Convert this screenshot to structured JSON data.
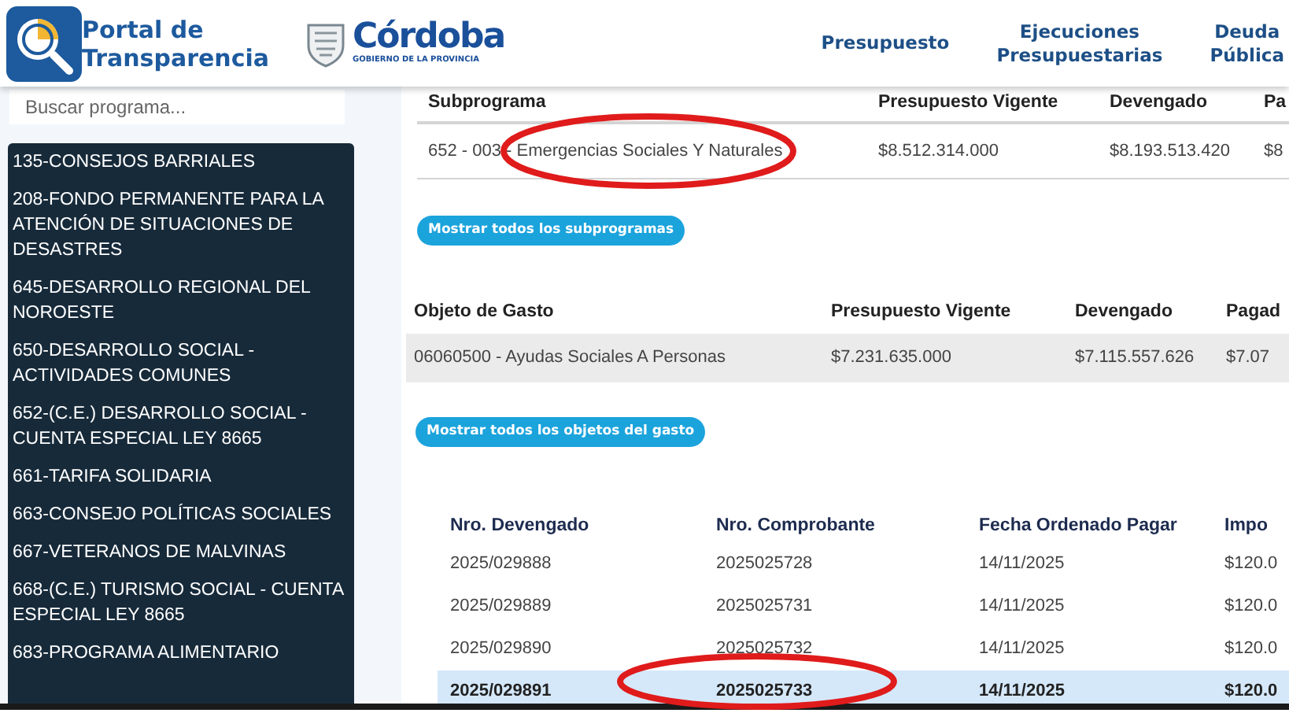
{
  "header": {
    "portal_title": [
      "Portal de",
      "Transparencia"
    ],
    "brand": "Córdoba",
    "brand_subtitle": "GOBIERNO DE LA PROVINCIA",
    "nav": [
      {
        "lines": [
          "Presupuesto"
        ]
      },
      {
        "lines": [
          "Ejecuciones",
          "Presupuestarias"
        ]
      },
      {
        "lines": [
          "Deuda",
          "Pública"
        ]
      }
    ]
  },
  "sidebar": {
    "search": {
      "placeholder": "Buscar programa..."
    },
    "items": [
      {
        "label": "135-CONSEJOS BARRIALES"
      },
      {
        "label": "208-FONDO PERMANENTE PARA LA ATENCIÓN DE SITUACIONES DE DESASTRES"
      },
      {
        "label": "645-DESARROLLO REGIONAL DEL NOROESTE"
      },
      {
        "label": "650-DESARROLLO SOCIAL - ACTIVIDADES COMUNES"
      },
      {
        "label": "652-(C.E.) DESARROLLO SOCIAL - CUENTA ESPECIAL LEY 8665"
      },
      {
        "label": "661-TARIFA SOLIDARIA"
      },
      {
        "label": "663-CONSEJO POLÍTICAS SOCIALES"
      },
      {
        "label": "667-VETERANOS DE MALVINAS"
      },
      {
        "label": "668-(C.E.) TURISMO SOCIAL - CUENTA ESPECIAL LEY 8665"
      },
      {
        "label": "683-PROGRAMA ALIMENTARIO"
      }
    ]
  },
  "subprogram_table": {
    "columns": [
      "Subprograma",
      "Presupuesto Vigente",
      "Devengado",
      "Pa"
    ],
    "rows": [
      {
        "cells": [
          "652 - 003 - Emergencias Sociales Y Naturales",
          "$8.512.314.000",
          "$8.193.513.420",
          "$8"
        ],
        "selected": false
      }
    ],
    "button": "Mostrar todos los subprogramas"
  },
  "expense_table": {
    "columns": [
      "Objeto de Gasto",
      "Presupuesto Vigente",
      "Devengado",
      "Pagad"
    ],
    "rows": [
      {
        "cells": [
          "06060500 - Ayudas Sociales A Personas",
          "$7.231.635.000",
          "$7.115.557.626",
          "$7.07"
        ],
        "selected": true
      }
    ],
    "button": "Mostrar todos los objetos del gasto"
  },
  "accrual_table": {
    "columns": [
      "Nro. Devengado",
      "Nro. Comprobante",
      "Fecha Ordenado Pagar",
      "Impo"
    ],
    "rows": [
      {
        "cells": [
          "2025/029888",
          "2025025728",
          "14/11/2025",
          "$120.0"
        ],
        "selected": false
      },
      {
        "cells": [
          "2025/029889",
          "2025025731",
          "14/11/2025",
          "$120.0"
        ],
        "selected": false
      },
      {
        "cells": [
          "2025/029890",
          "2025025732",
          "14/11/2025",
          "$120.0"
        ],
        "selected": false
      },
      {
        "cells": [
          "2025/029891",
          "2025025733",
          "14/11/2025",
          "$120.0"
        ],
        "selected": true
      }
    ]
  }
}
